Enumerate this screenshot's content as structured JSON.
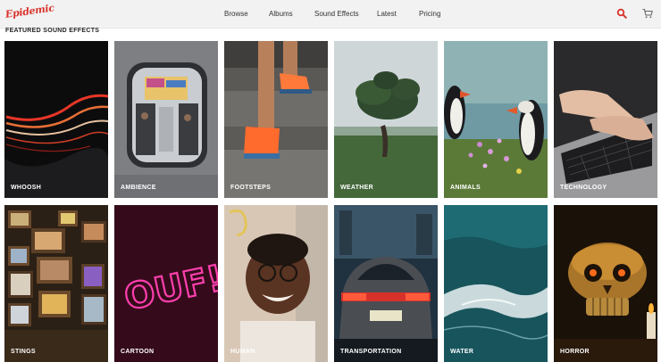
{
  "header": {
    "logo_text": "Epidemic",
    "nav": [
      "Browse",
      "Albums",
      "Sound Effects",
      "Latest",
      "Pricing"
    ],
    "search_icon": "search-icon",
    "cart_icon": "cart-icon",
    "accent_color": "#d8332c"
  },
  "section": {
    "title": "FEATURED SOUND EFFECTS"
  },
  "tiles": [
    {
      "label": "WHOOSH"
    },
    {
      "label": "AMBIENCE"
    },
    {
      "label": "FOOTSTEPS"
    },
    {
      "label": "WEATHER"
    },
    {
      "label": "ANIMALS"
    },
    {
      "label": "TECHNOLOGY"
    },
    {
      "label": "STINGS"
    },
    {
      "label": "CARTOON"
    },
    {
      "label": "HUMAN"
    },
    {
      "label": "TRANSPORTATION"
    },
    {
      "label": "WATER"
    },
    {
      "label": "HORROR"
    }
  ],
  "image_texts": {
    "cartoon_neon": "OUF!"
  }
}
